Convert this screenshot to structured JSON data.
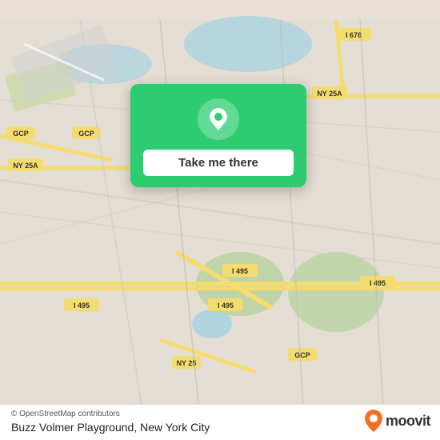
{
  "map": {
    "attribution": "© OpenStreetMap contributors",
    "background_color": "#e4ddd4"
  },
  "popup": {
    "button_label": "Take me there",
    "background_color": "#2ecc71"
  },
  "bottom_bar": {
    "location_name": "Buzz Volmer Playground, New York City",
    "copyright_text": "© OpenStreetMap contributors"
  },
  "moovit": {
    "logo_text": "moovit"
  }
}
